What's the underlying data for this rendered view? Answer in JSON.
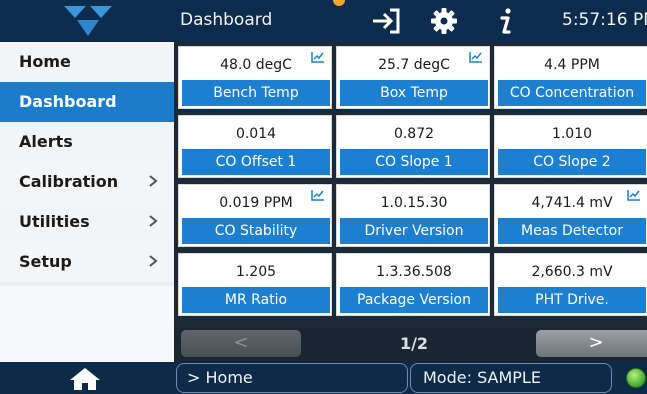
{
  "header": {
    "title": "Dashboard",
    "time": "5:57:16 PM",
    "icons": [
      "logo",
      "enter-icon",
      "gear-icon",
      "info-icon"
    ]
  },
  "sidebar": {
    "items": [
      {
        "label": "Home",
        "has_submenu": false,
        "active": false
      },
      {
        "label": "Dashboard",
        "has_submenu": false,
        "active": true
      },
      {
        "label": "Alerts",
        "has_submenu": false,
        "active": false
      },
      {
        "label": "Calibration",
        "has_submenu": true,
        "active": false
      },
      {
        "label": "Utilities",
        "has_submenu": true,
        "active": false
      },
      {
        "label": "Setup",
        "has_submenu": true,
        "active": false
      }
    ]
  },
  "tiles": [
    {
      "value": "48.0 degC",
      "label": "Bench Temp",
      "trend": true
    },
    {
      "value": "25.7 degC",
      "label": "Box Temp",
      "trend": true
    },
    {
      "value": "4.4 PPM",
      "label": "CO Concentration",
      "trend": false
    },
    {
      "value": "0.014",
      "label": "CO Offset 1",
      "trend": false
    },
    {
      "value": "0.872",
      "label": "CO Slope 1",
      "trend": false
    },
    {
      "value": "1.010",
      "label": "CO Slope 2",
      "trend": false
    },
    {
      "value": "0.019 PPM",
      "label": "CO Stability",
      "trend": true
    },
    {
      "value": "1.0.15.30",
      "label": "Driver Version",
      "trend": false
    },
    {
      "value": "4,741.4 mV",
      "label": "Meas Detector",
      "trend": true
    },
    {
      "value": "1.205",
      "label": "MR Ratio",
      "trend": false
    },
    {
      "value": "1.3.36.508",
      "label": "Package Version",
      "trend": false
    },
    {
      "value": "2,660.3 mV",
      "label": "PHT Drive.",
      "trend": false
    }
  ],
  "pager": {
    "prev_label": "<",
    "next_label": ">",
    "page_text": "1/2"
  },
  "footer": {
    "breadcrumb": "> Home",
    "mode": "Mode: SAMPLE"
  },
  "colors": {
    "accent": "#1d7fd0",
    "topbar": "#0c2c4d",
    "status_ok": "#3ea82c"
  }
}
